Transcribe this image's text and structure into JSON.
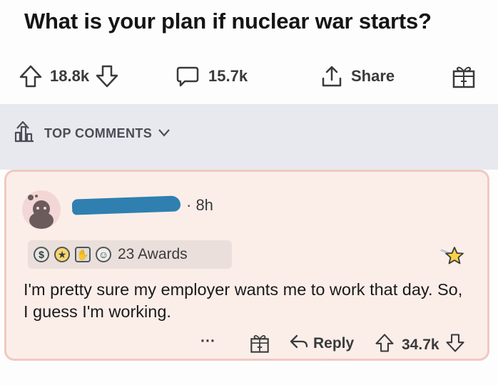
{
  "post": {
    "title": "What is your plan if nuclear war starts?",
    "upvotes": "18.8k",
    "comments": "15.7k",
    "share_label": "Share"
  },
  "comments_section": {
    "sort_label": "TOP COMMENTS"
  },
  "comment": {
    "age": "· 8h",
    "awards_count": "23 Awards",
    "text": "I'm pretty sure my employer wants me to work that day. So, I guess I'm working.",
    "more": "···",
    "reply_label": "Reply",
    "votes": "34.7k"
  },
  "colors": {
    "accent_card_bg": "#fbeee9",
    "card_border": "#f2c8c0",
    "redaction": "#2f7fb0"
  },
  "icons": [
    "upvote-icon",
    "downvote-icon",
    "comment-icon",
    "share-icon",
    "gift-icon",
    "top-comments-icon",
    "chevron-down-icon",
    "star-icon",
    "reply-icon"
  ]
}
